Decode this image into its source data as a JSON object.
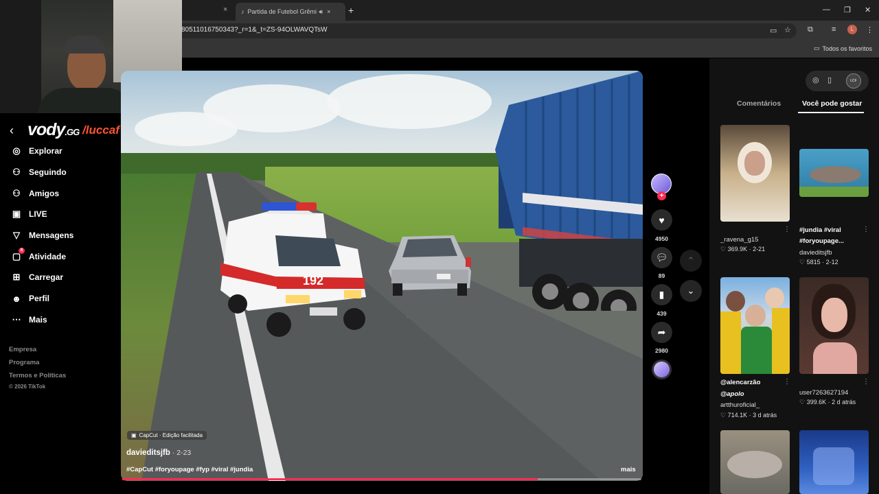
{
  "browser": {
    "tab_inactive_close": "×",
    "tab_active_title": "Partida de Futebol Grêmio",
    "tab_new": "+",
    "url": "80511016750343?_r=1&_t=ZS-94OLWAVQTsW",
    "bookmarks_label": "Todos os favoritos",
    "window_controls": [
      "—",
      "❐",
      "✕"
    ]
  },
  "overlay": {
    "brand": "vody",
    "brand_suffix": ".GG",
    "handle": "/luccaf"
  },
  "sidebar": {
    "items": [
      {
        "label": "Explorar",
        "icon": "compass-icon",
        "glyph": "◎"
      },
      {
        "label": "Seguindo",
        "icon": "following-icon",
        "glyph": "⚇"
      },
      {
        "label": "Amigos",
        "icon": "friends-icon",
        "glyph": "⚇"
      },
      {
        "label": "LIVE",
        "icon": "live-icon",
        "glyph": "▣"
      },
      {
        "label": "Mensagens",
        "icon": "messages-icon",
        "glyph": "▽"
      },
      {
        "label": "Atividade",
        "icon": "activity-icon",
        "glyph": "▢",
        "badge": "8"
      },
      {
        "label": "Carregar",
        "icon": "upload-icon",
        "glyph": "⊞"
      },
      {
        "label": "Perfil",
        "icon": "profile-icon",
        "glyph": "☻"
      },
      {
        "label": "Mais",
        "icon": "more-icon",
        "glyph": "⋯"
      }
    ],
    "footer": [
      "Empresa",
      "Programa",
      "Termos e Políticas"
    ],
    "copyright": "© 2026 TikTok"
  },
  "video": {
    "capcut_badge": "CapCut · Edição facilitada",
    "author": "davieditsjfb",
    "date": " · 2-23",
    "tags": "#CapCut #foryoupage #fyp #viral #jundia",
    "more": "mais",
    "progress": 0.8,
    "ambulance_number": "192"
  },
  "actions": {
    "likes": "4950",
    "comments": "89",
    "saves": "439",
    "shares": "2980"
  },
  "panel": {
    "tab_comments": "Comentários",
    "tab_suggest": "Você pode gostar",
    "cards": [
      {
        "user": "_ravena_g15",
        "stats": "♡ 369.9K · 2-21"
      },
      {
        "title": "#jundia #viral #foryoupage...",
        "user": "davieditsjfb",
        "stats": "♡ 5815 · 2-12"
      },
      {
        "title": "@alencarzão",
        "title2": "@apolo",
        "user": "artthuroficial_",
        "stats": "♡ 714.1K · 3 d atrás"
      },
      {
        "user": "user7263627194",
        "stats": "♡ 399.6K · 2 d atrás"
      }
    ]
  },
  "colors": {
    "accent": "#fe2c55",
    "overlay_red": "#c0341d",
    "truck_blue": "#2c5a9c"
  }
}
